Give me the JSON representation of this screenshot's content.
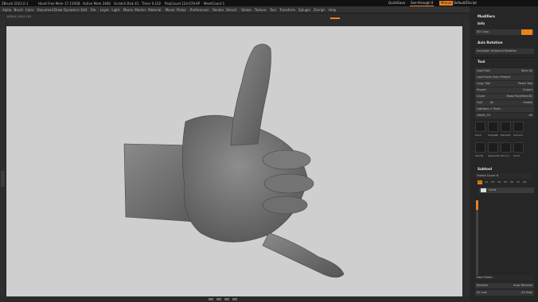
{
  "titlebar": {
    "app_title": "ZBrush 2022.0.1",
    "items": [
      "Hand",
      "Free Mem 17.119GB",
      "Active Mem 2460",
      "Scratch Disk 41",
      "Timer 0.102",
      "PolyCount 124.678 KP",
      "MeshCount 1"
    ],
    "quicksave": "QuickSave",
    "see_through": "See-through 0",
    "menus_label": "Menus",
    "defaultzscript": "DefaultZScript"
  },
  "menubar": {
    "items": [
      "Alpha",
      "Brush",
      "Color",
      "Document",
      "Draw",
      "Dynamics",
      "Edit",
      "File",
      "Layer",
      "Light",
      "Macro",
      "Marker",
      "Material",
      "Movie",
      "Picker",
      "Preferences",
      "Render",
      "Stencil",
      "Stroke",
      "Texture",
      "Tool",
      "Transform",
      "Zplugin",
      "Zscript",
      "Help"
    ]
  },
  "status": "1406.0.100.0.105",
  "panel": {
    "headers": {
      "modifiers": "Modifiers",
      "info": "Info",
      "axis_rotation": "Axis Rotation",
      "tool": "Tool",
      "subtool": "Subtool"
    },
    "rows": {
      "grid_label": "3D Copy",
      "rotation": "Axis/plan Unbound Rotation",
      "load_tool": "Load Tool",
      "save_as": "Save As",
      "load_tools_from_project": "Load Tools From Project",
      "copy_tool": "Copy Tool",
      "paste_tool": "Paste Tool",
      "import": "Import",
      "export": "Export",
      "clone": "Clone",
      "make_polymesh": "Make PolyMesh3D",
      "goz": "GoZ",
      "all": "All",
      "visible": "Visible",
      "r": "R",
      "lightbox_tools": "Lightbox > Tools",
      "hand_count": "HAND_50",
      "hand_value": "48",
      "vis_count": "Visible Count 8",
      "new_folder": "New Folder",
      "list_all": "List All",
      "auto_collapse": "Auto Collapse",
      "bottom1_a": "Remesh",
      "bottom1_b": "Auto Remesh",
      "bottom2_a": "All Low",
      "bottom2_b": "All High"
    },
    "tools": [
      {
        "label": "Hand"
      },
      {
        "label": "SimpleB..."
      },
      {
        "label": "Plane3D"
      },
      {
        "label": "Camera"
      },
      {
        "label": "Star3D"
      },
      {
        "label": "Sphere3D"
      },
      {
        "label": "Hand_1"
      },
      {
        "label": "Hand"
      }
    ],
    "subtool_chips": [
      "V1",
      "V2",
      "V3",
      "V4",
      "V5",
      "V6",
      "V7",
      "V8"
    ],
    "subtool_name": "hand"
  },
  "colors": {
    "accent": "#e8821e",
    "canvas": "#cfcfcf",
    "panel": "#262626"
  }
}
